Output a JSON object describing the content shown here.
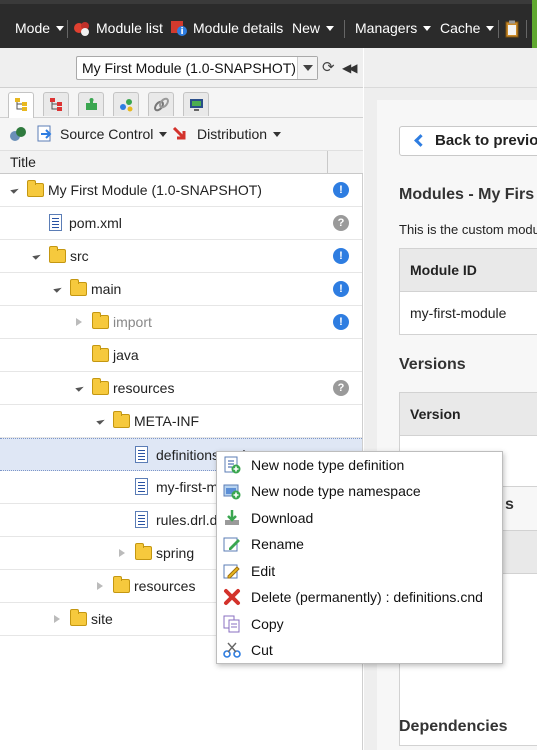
{
  "topbar": {
    "mode": "Mode",
    "module_list": "Module list",
    "module_details": "Module details",
    "new": "New",
    "managers": "Managers",
    "cache": "Cache"
  },
  "left": {
    "module_select": "My First Module (1.0-SNAPSHOT)",
    "toolbar": {
      "source_control": "Source Control",
      "distribution": "Distribution"
    },
    "column_title": "Title",
    "tree": [
      {
        "label": "My First Module (1.0-SNAPSHOT)",
        "status": "!"
      },
      {
        "label": "pom.xml",
        "status": "?"
      },
      {
        "label": "src",
        "status": "!"
      },
      {
        "label": "main",
        "status": "!"
      },
      {
        "label": "import",
        "status": "!"
      },
      {
        "label": "java",
        "status": ""
      },
      {
        "label": "resources",
        "status": "?"
      },
      {
        "label": "META-INF",
        "status": ""
      },
      {
        "label": "definitions.cnd",
        "status": ""
      },
      {
        "label": "my-first-m",
        "status": ""
      },
      {
        "label": "rules.drl.di",
        "status": ""
      },
      {
        "label": "spring",
        "status": ""
      },
      {
        "label": "resources",
        "status": ""
      },
      {
        "label": "site",
        "status": ""
      }
    ]
  },
  "right": {
    "back_button": "Back to previou",
    "modules_heading": "Modules - My Firs",
    "description": "This is the custom modu",
    "module_id_header": "Module ID",
    "module_id_value": "my-first-module",
    "versions_heading": "Versions",
    "version_header": "Version",
    "partial_heading": "s",
    "dependencies_heading": "Dependencies"
  },
  "context_menu": {
    "items": [
      "New node type definition",
      "New node type namespace",
      "Download",
      "Rename",
      "Edit",
      "Delete (permanently) : definitions.cnd",
      "Copy",
      "Cut"
    ]
  },
  "colors": {
    "topbar": "#2b2b2b",
    "accent_blue": "#2e7de1",
    "folder": "#f6c93d",
    "selected_row": "#dfe7f5"
  }
}
